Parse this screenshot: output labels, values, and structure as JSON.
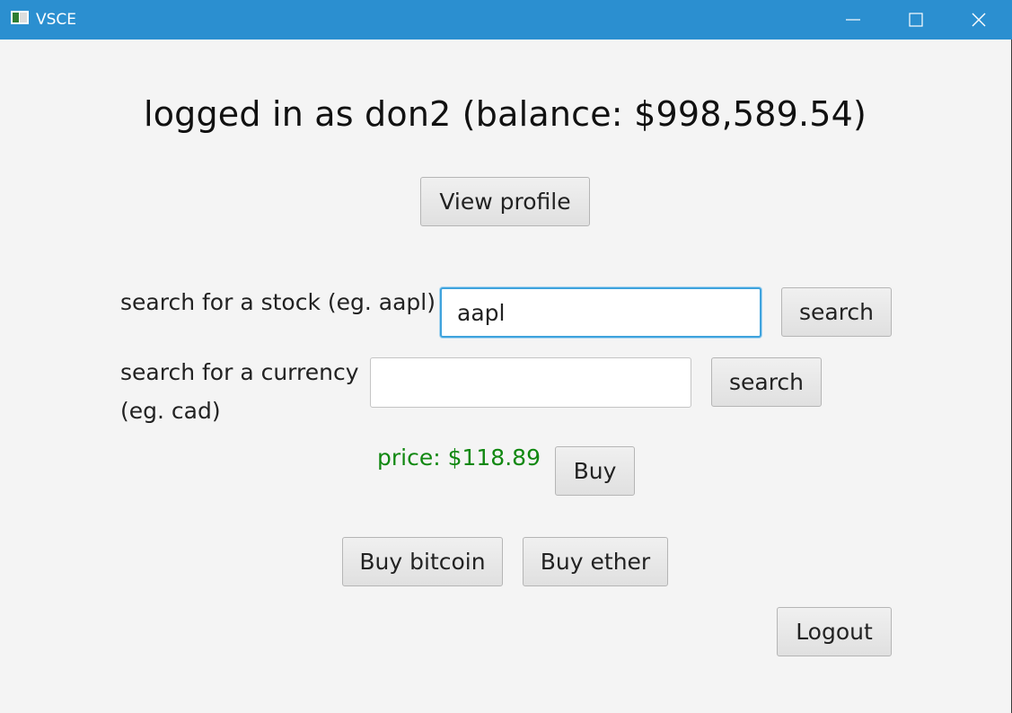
{
  "window": {
    "title": "VSCE",
    "controls": {
      "minimize_icon": "minimize-icon",
      "maximize_icon": "maximize-icon",
      "close_icon": "close-icon"
    }
  },
  "main": {
    "heading": "logged in as don2 (balance: $998,589.54)",
    "view_profile_label": "View profile",
    "stock_search": {
      "label": "search for a stock (eg. aapl)",
      "value": "aapl",
      "button_label": "search"
    },
    "currency_search": {
      "label_line1": "search for a currency",
      "label_line2": "(eg. cad)",
      "value": "",
      "button_label": "search"
    },
    "price_text": "price: $118.89",
    "buy_label": "Buy",
    "buy_bitcoin_label": "Buy bitcoin",
    "buy_ether_label": "Buy ether",
    "logout_label": "Logout"
  },
  "colors": {
    "titlebar": "#2b8fd0",
    "price_text": "#118811",
    "focus_border": "#3fa3dd",
    "background": "#f4f4f4"
  }
}
